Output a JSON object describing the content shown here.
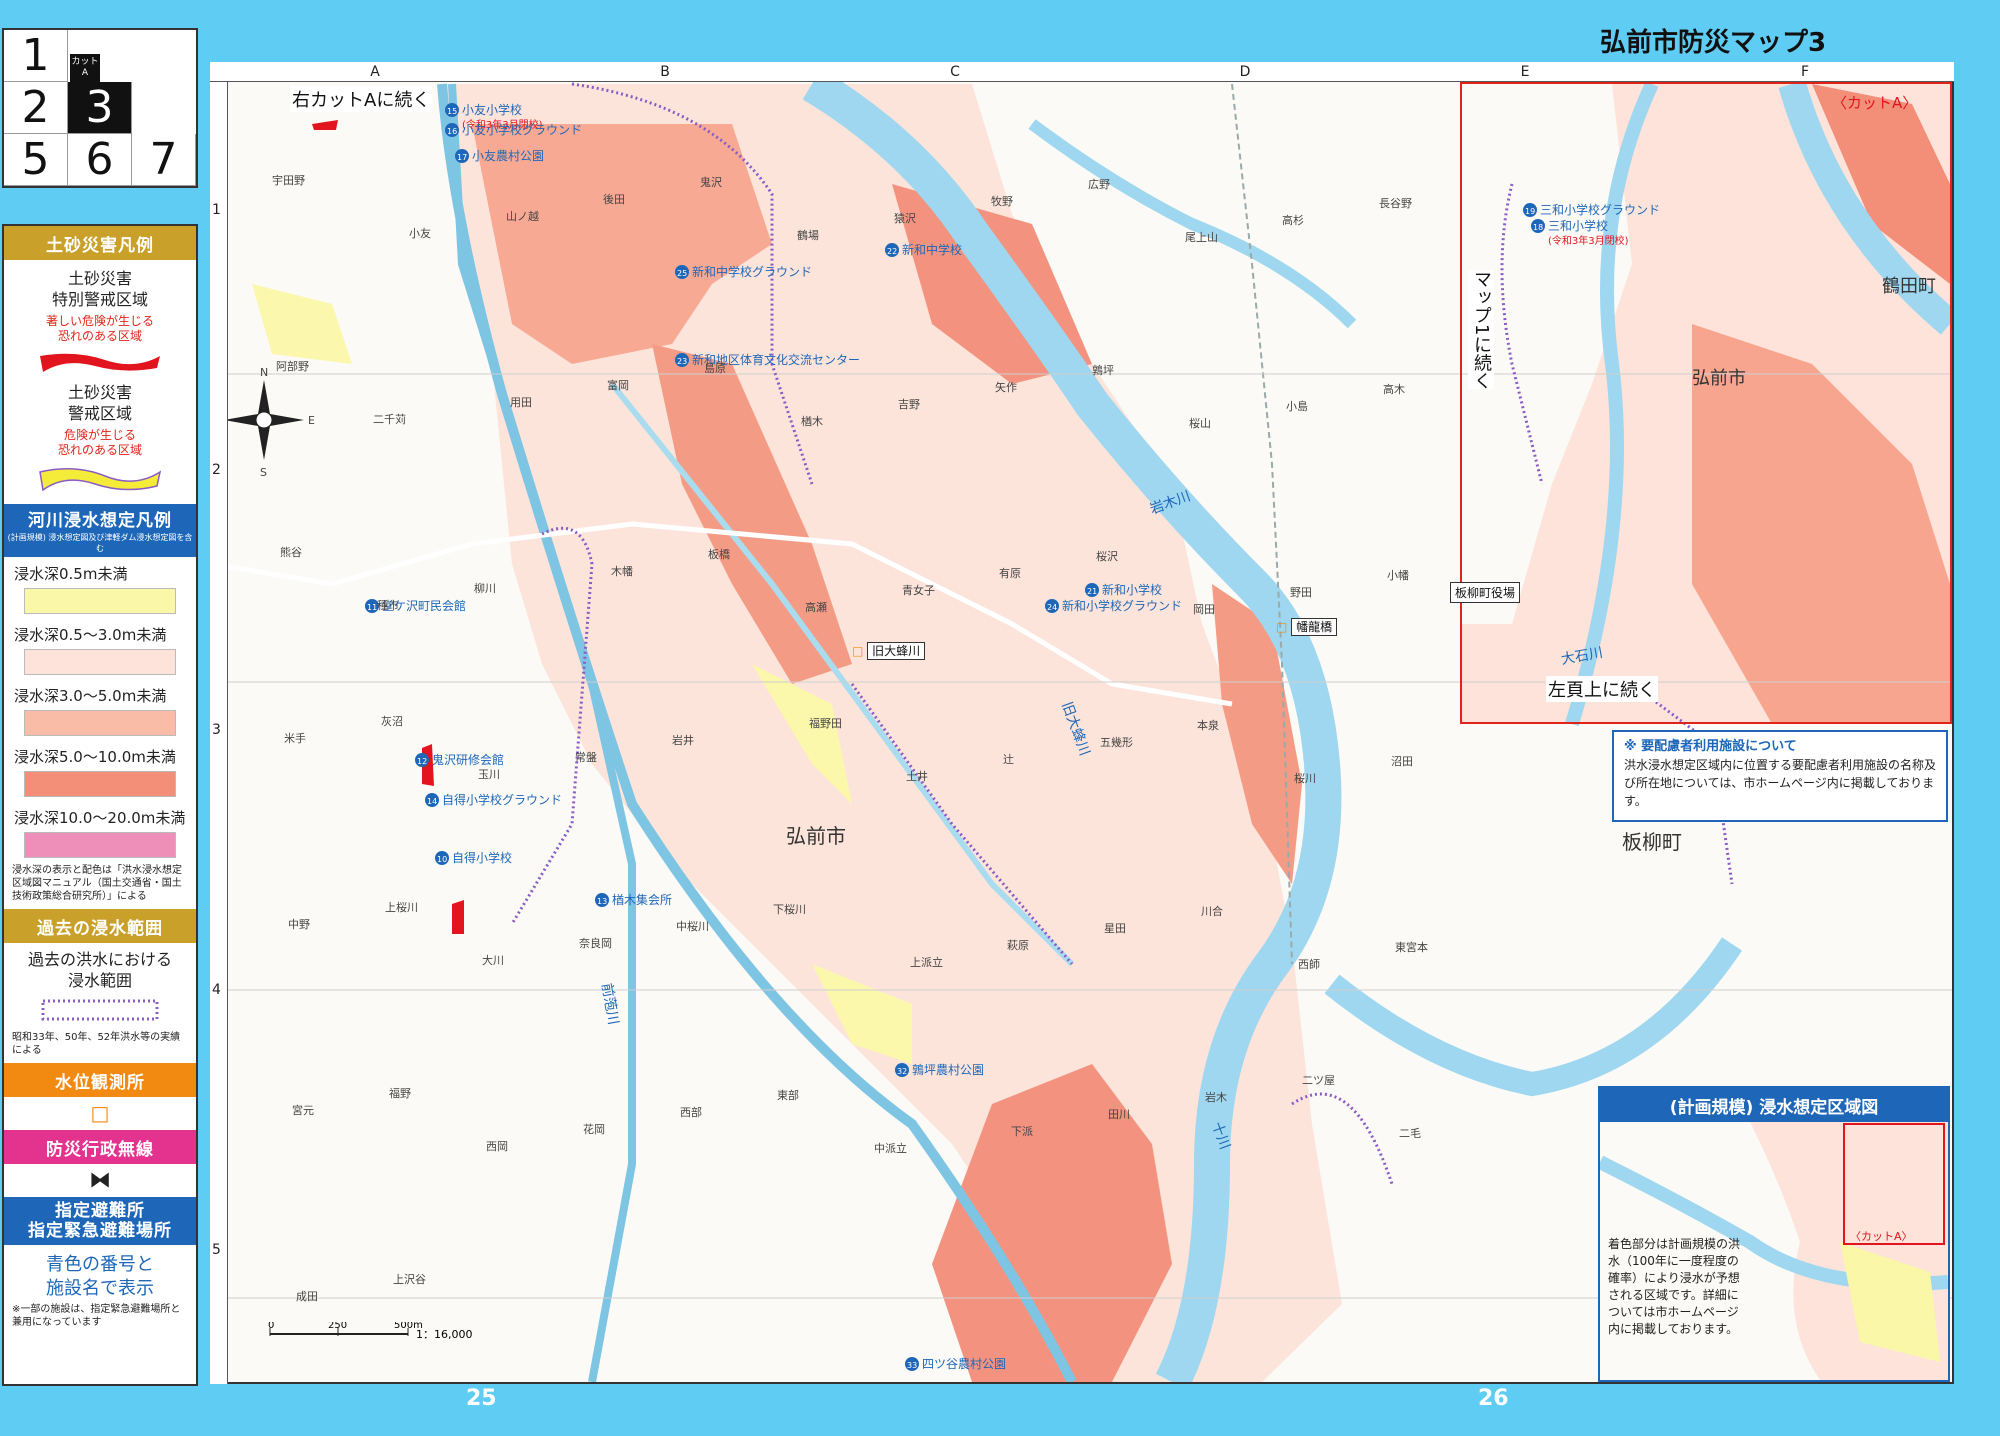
{
  "page": {
    "title": "弘前市防災マップ3",
    "page_numbers": [
      "25",
      "26"
    ]
  },
  "page_index": {
    "cells": [
      "1",
      "2",
      "3",
      "5",
      "6",
      "7"
    ],
    "current": "3",
    "cut_label": "カット A"
  },
  "legend": {
    "landslide": {
      "header": "土砂災害凡例",
      "special_title": "土砂災害\n特別警戒区域",
      "special_desc": "著しい危険が生じる\n恐れのある区域",
      "warning_title": "土砂災害\n警戒区域",
      "warning_desc": "危険が生じる\n恐れのある区域",
      "special_color": "#e2141e",
      "warning_color": "#f5ec3a"
    },
    "flood": {
      "header": "河川浸水想定凡例",
      "subheader": "(計画規模) 浸水想定図及び津軽ダム浸水想定図を含む",
      "levels": [
        {
          "label": "浸水深0.5m未満",
          "color": "#fbf7a8"
        },
        {
          "label": "浸水深0.5～3.0m未満",
          "color": "#fde3d9"
        },
        {
          "label": "浸水深3.0～5.0m未満",
          "color": "#f9bca6"
        },
        {
          "label": "浸水深5.0～10.0m未満",
          "color": "#f38e79"
        },
        {
          "label": "浸水深10.0～20.0m未満",
          "color": "#ee8fb9"
        }
      ],
      "note": "浸水深の表示と配色は「洪水浸水想定区域図マニュアル（国土交通省・国土技術政策総合研究所）」による"
    },
    "past_flood": {
      "header": "過去の浸水範囲",
      "title": "過去の洪水における\n浸水範囲",
      "note": "昭和33年、50年、52年洪水等の実績による",
      "color": "#8b5cc4"
    },
    "water_level": {
      "header": "水位観測所",
      "symbol": "□",
      "color": "#f28a12"
    },
    "radio": {
      "header": "防災行政無線",
      "symbol": "⧓"
    },
    "shelter": {
      "header": "指定避難所\n指定緊急避難場所",
      "desc": "青色の番号と\n施設名で表示",
      "note": "※一部の施設は、指定緊急避難場所と兼用になっています"
    }
  },
  "map": {
    "columns": [
      "A",
      "B",
      "C",
      "D",
      "E",
      "F"
    ],
    "rows": [
      "1",
      "2",
      "3",
      "4",
      "5"
    ],
    "continue_labels": {
      "right_cut": "右カットAに続く",
      "map1": "マップ1に続く",
      "left_top": "左頁上に続く"
    },
    "facilities": [
      {
        "no": "15",
        "name": "小友小学校",
        "note": "(令和3年3月閉校)"
      },
      {
        "no": "16",
        "name": "小友小学校グラウンド"
      },
      {
        "no": "17",
        "name": "小友農村公園"
      },
      {
        "no": "22",
        "name": "新和中学校"
      },
      {
        "no": "25",
        "name": "新和中学校グラウンド"
      },
      {
        "no": "23",
        "name": "新和地区体育文化交流センター"
      },
      {
        "no": "21",
        "name": "新和小学校"
      },
      {
        "no": "24",
        "name": "新和小学校グラウンド"
      },
      {
        "no": "11",
        "name": "堂ケ沢町民会館"
      },
      {
        "no": "12",
        "name": "鬼沢研修会館"
      },
      {
        "no": "14",
        "name": "自得小学校グラウンド"
      },
      {
        "no": "10",
        "name": "自得小学校"
      },
      {
        "no": "13",
        "name": "楢木集会所"
      },
      {
        "no": "32",
        "name": "鶉坪農村公園"
      },
      {
        "no": "33",
        "name": "四ツ谷農村公園"
      },
      {
        "no": "19",
        "name": "三和小学校グラウンド"
      },
      {
        "no": "18",
        "name": "三和小学校",
        "note": "(令和3年3月閉校)"
      }
    ],
    "gauges": [
      "旧大蜂川",
      "幡龍橋"
    ],
    "rivers": [
      "岩木川",
      "旧大蜂川",
      "大石川",
      "前萢川",
      "十川"
    ],
    "towns": [
      "弘前市",
      "板柳町",
      "鶴田町",
      "弘前市"
    ],
    "offices": [
      "板柳町役場"
    ],
    "places": [
      "宇田野",
      "小友",
      "山ノ越",
      "後田",
      "鬼沢",
      "鶴場",
      "猿沢",
      "牧野",
      "広野",
      "尾上山",
      "高杉",
      "長谷野",
      "阿部野",
      "二千苅",
      "用田",
      "富岡",
      "島原",
      "楢木",
      "吉野",
      "矢作",
      "鶉坪",
      "桜山",
      "小島",
      "高木",
      "熊谷",
      "種市",
      "柳川",
      "木幡",
      "板橋",
      "高瀬",
      "青女子",
      "有原",
      "桜沢",
      "岡田",
      "野田",
      "小幡",
      "米手",
      "灰沼",
      "玉川",
      "常盤",
      "岩井",
      "福野田",
      "土井",
      "辻",
      "五幾形",
      "本泉",
      "桜川",
      "沼田",
      "中野",
      "上桜川",
      "大川",
      "奈良岡",
      "中桜川",
      "下桜川",
      "上派立",
      "萩原",
      "星田",
      "川合",
      "西師",
      "東宮本",
      "宮元",
      "福野",
      "西岡",
      "花岡",
      "西部",
      "東部",
      "中派立",
      "下派",
      "田川",
      "岩木",
      "二ツ屋",
      "二毛",
      "成田",
      "上沢谷"
    ],
    "cut_panel": {
      "label": "〈カットA〉",
      "towns": [
        "鶴田町",
        "弘前市"
      ]
    },
    "scale": {
      "ticks": [
        "0",
        "250",
        "500m"
      ],
      "ratio": "1：16,000"
    }
  },
  "info_note": {
    "title": "※ 要配慮者利用施設について",
    "body": "洪水浸水想定区域内に位置する要配慮者利用施設の名称及び所在地については、市ホームページ内に掲載しております。"
  },
  "plan_box": {
    "title": "(計画規模) 浸水想定区域図",
    "cut_label": "〈カットA〉",
    "desc": "着色部分は計画規模の洪水（100年に一度程度の確率）により浸水が予想される区域です。詳細については市ホームページ内に掲載しております。"
  }
}
